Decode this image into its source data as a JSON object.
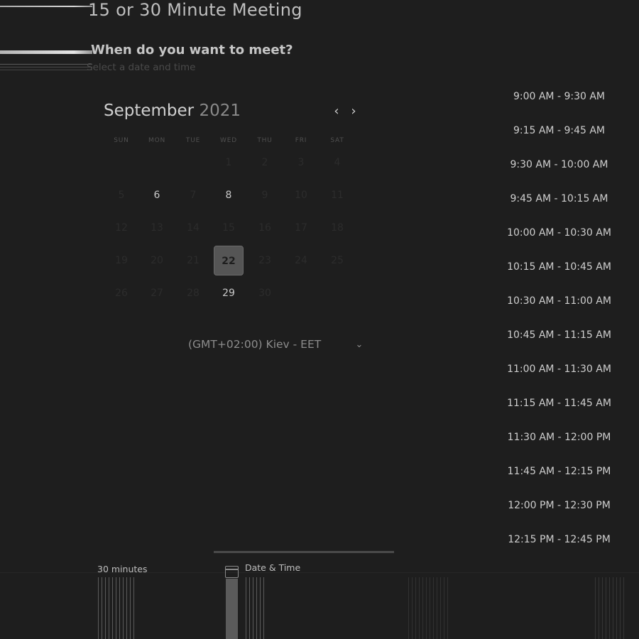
{
  "page": {
    "title": "15 or 30 Minute Meeting",
    "question": "When do you want to meet?",
    "subtitle": "Select a date and time"
  },
  "calendar": {
    "month": "September",
    "year": "2021",
    "prev_label": "‹",
    "next_label": "›",
    "weekdays": [
      "SUN",
      "MON",
      "TUE",
      "WED",
      "THU",
      "FRI",
      "SAT"
    ],
    "weeks": [
      [
        "",
        "",
        "",
        "1",
        "2",
        "3",
        "4"
      ],
      [
        "5",
        "6",
        "7",
        "8",
        "9",
        "10",
        "11"
      ],
      [
        "12",
        "13",
        "14",
        "15",
        "16",
        "17",
        "18"
      ],
      [
        "19",
        "20",
        "21",
        "22",
        "23",
        "24",
        "25"
      ],
      [
        "26",
        "27",
        "28",
        "29",
        "30",
        "",
        ""
      ]
    ],
    "visible_days": [
      "8",
      "22",
      "6",
      "29"
    ],
    "selected_day": "22"
  },
  "timezone": {
    "value": "(GMT+02:00) Kiev - EET",
    "chevron": "⌄"
  },
  "time_slots": [
    "9:00 AM - 9:30 AM",
    "9:15 AM - 9:45 AM",
    "9:30 AM - 10:00 AM",
    "9:45 AM - 10:15 AM",
    "10:00 AM - 10:30 AM",
    "10:15 AM - 10:45 AM",
    "10:30 AM - 11:00 AM",
    "10:45 AM - 11:15 AM",
    "11:00 AM - 11:30 AM",
    "11:15 AM - 11:45 AM",
    "11:30 AM - 12:00 PM",
    "11:45 AM - 12:15 PM",
    "12:00 PM - 12:30 PM",
    "12:15 PM - 12:45 PM"
  ],
  "tabs": {
    "duration_label": "30 minutes",
    "datetime_label": "Date & Time"
  },
  "colors": {
    "background": "#1e1e1e",
    "selected_day": "#555555",
    "text": "#cfcfcf"
  }
}
